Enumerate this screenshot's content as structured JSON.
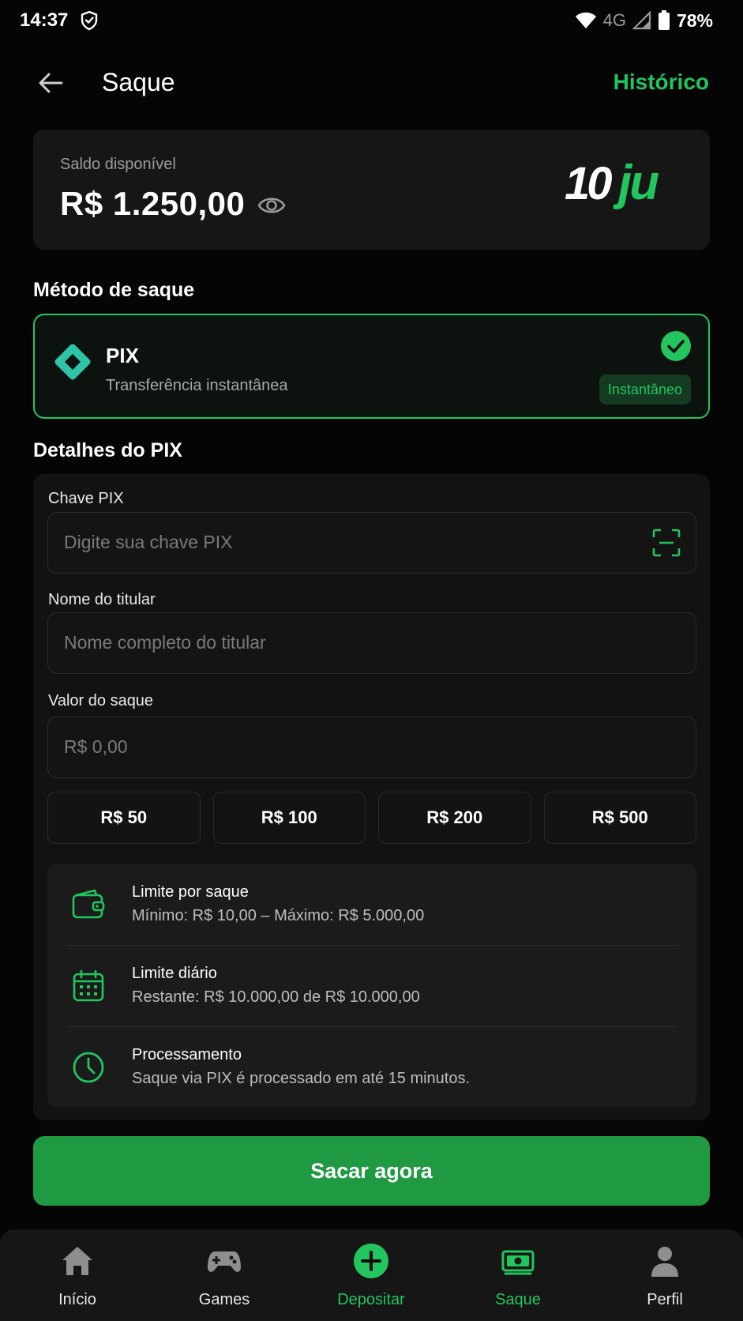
{
  "status_bar": {
    "time": "14:37",
    "network": "4G",
    "battery": "78%"
  },
  "header": {
    "title": "Saque",
    "history_link": "Histórico"
  },
  "balance": {
    "label": "Saldo disponível",
    "value": "R$ 1.250,00",
    "brand": "10ju"
  },
  "method_section": {
    "title": "Método de saque",
    "pix": {
      "name": "PIX",
      "description": "Transferência instantânea",
      "badge": "Instantâneo",
      "selected": true
    }
  },
  "details_section": {
    "title": "Detalhes do PIX",
    "fields": {
      "pix_key": {
        "label": "Chave PIX",
        "placeholder": "Digite sua chave PIX",
        "value": ""
      },
      "holder": {
        "label": "Nome do titular",
        "placeholder": "Nome completo do titular",
        "value": ""
      },
      "amount": {
        "label": "Valor do saque",
        "placeholder": "R$ 0,00",
        "value": ""
      }
    },
    "quick_amounts": [
      "R$ 50",
      "R$ 100",
      "R$ 200",
      "R$ 500"
    ],
    "info": [
      {
        "title": "Limite por saque",
        "subtitle": "Mínimo: R$ 10,00 – Máximo: R$ 5.000,00",
        "icon": "wallet-icon"
      },
      {
        "title": "Limite diário",
        "subtitle": "Restante: R$ 10.000,00 de R$ 10.000,00",
        "icon": "calendar-icon"
      },
      {
        "title": "Processamento",
        "subtitle": "Saque via PIX é processado em até 15 minutos.",
        "icon": "clock-icon"
      }
    ]
  },
  "primary_button": "Sacar agora",
  "bottom_nav": [
    {
      "label": "Início",
      "icon": "home-icon",
      "active": false
    },
    {
      "label": "Games",
      "icon": "gamepad-icon",
      "active": false
    },
    {
      "label": "Depositar",
      "icon": "plus-circle-icon",
      "active": false
    },
    {
      "label": "Saque",
      "icon": "cash-icon",
      "active": true
    },
    {
      "label": "Perfil",
      "icon": "user-icon",
      "active": false
    }
  ],
  "colors": {
    "accent": "#22c55e",
    "button": "#1f9a43",
    "background": "#050505",
    "card": "#161616"
  }
}
